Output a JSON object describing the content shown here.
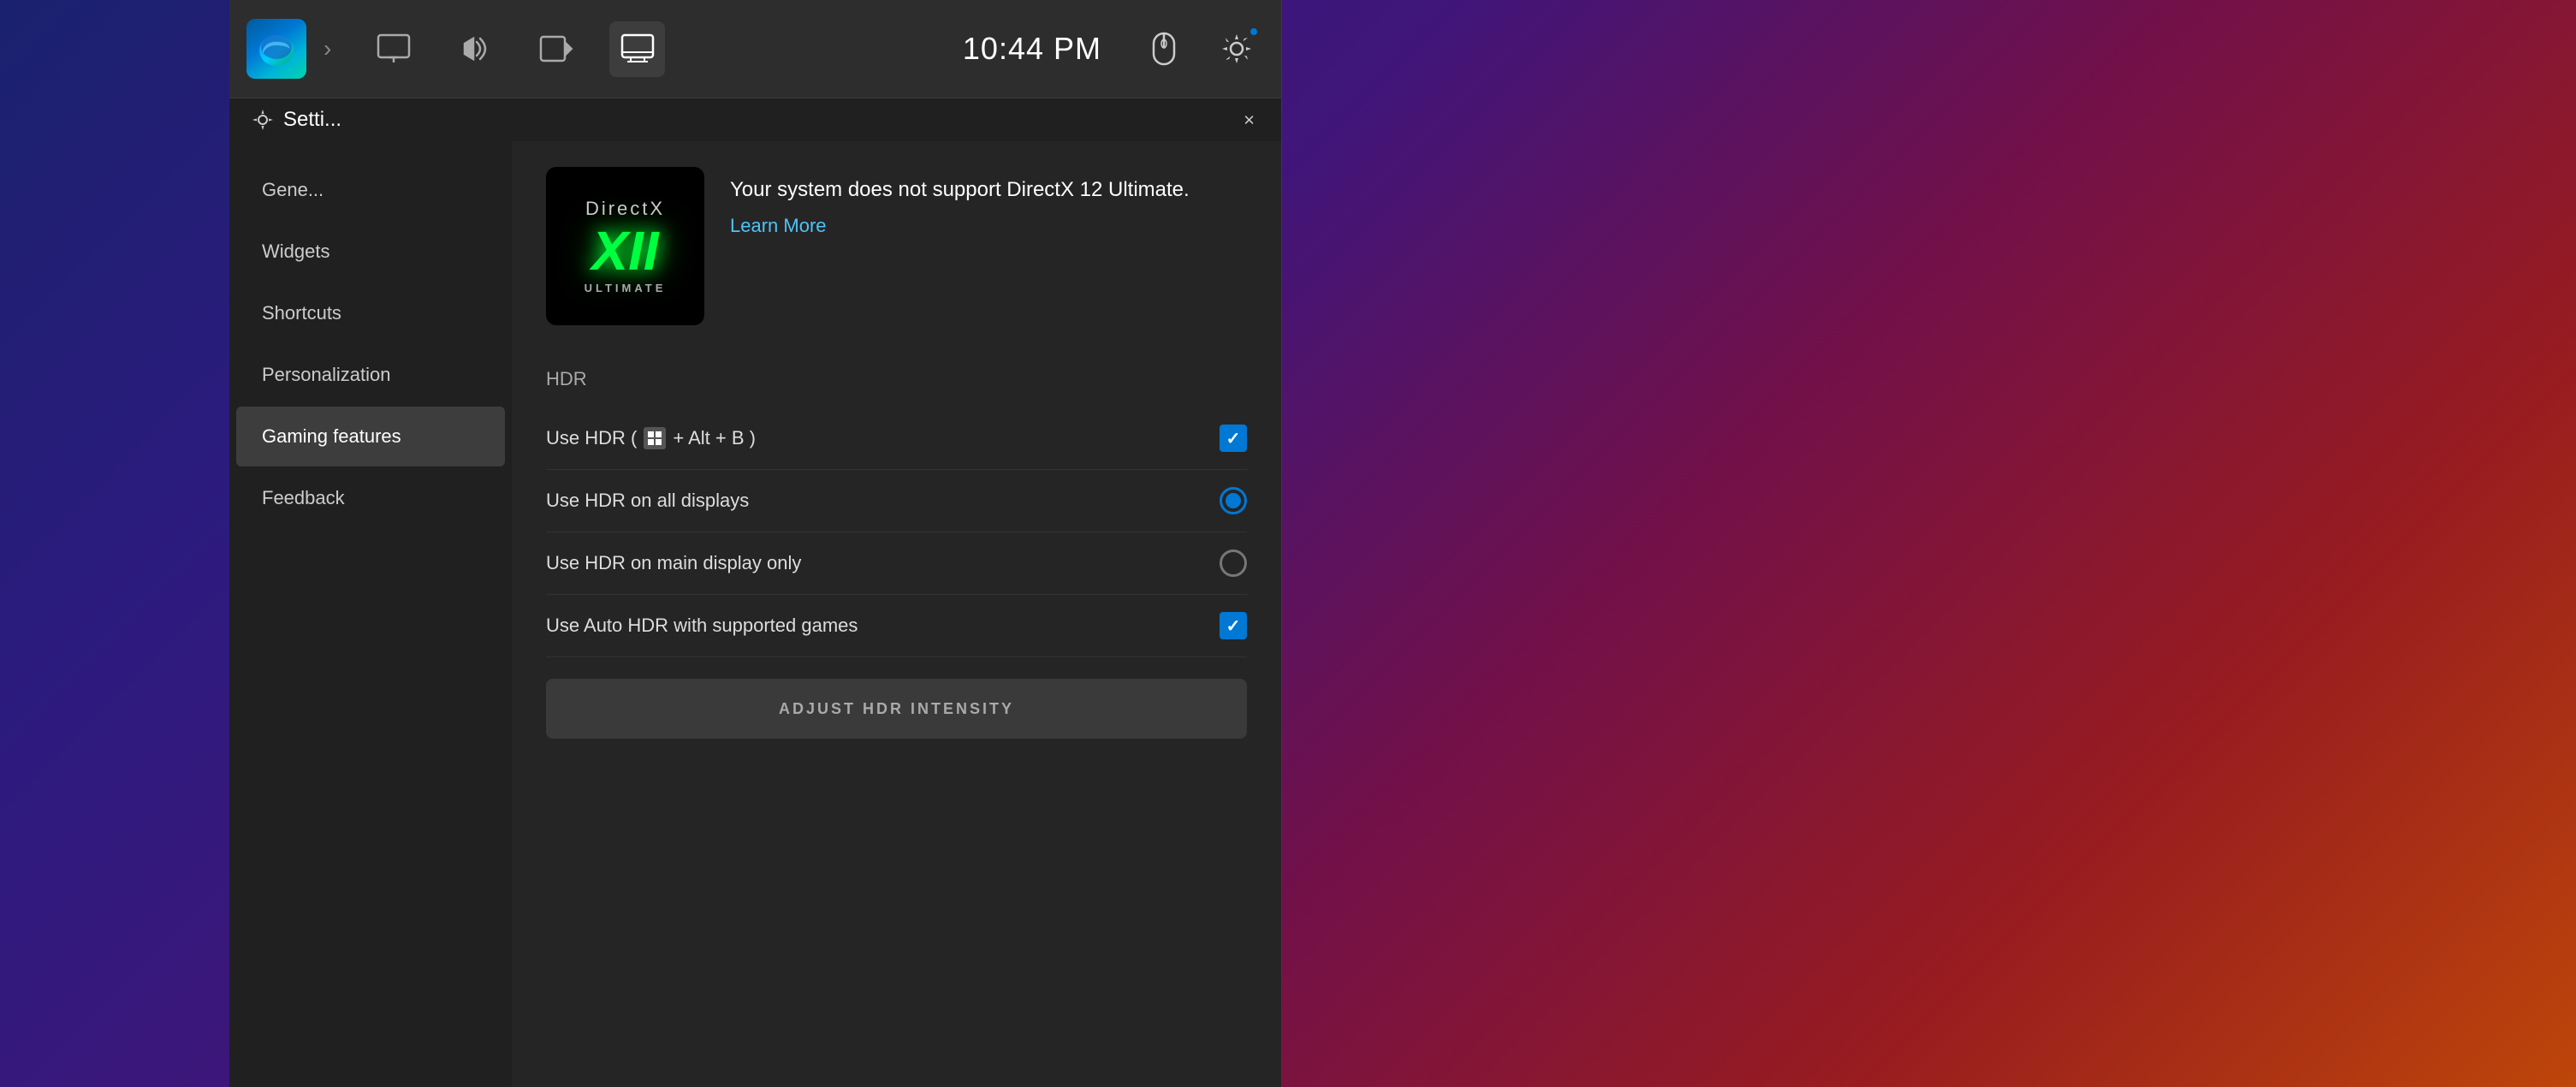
{
  "window": {
    "title": "Setti...",
    "close_label": "×"
  },
  "toolbar": {
    "time": "10:44 PM",
    "icons": [
      {
        "name": "display-icon",
        "label": "Display"
      },
      {
        "name": "audio-icon",
        "label": "Audio"
      },
      {
        "name": "screen-record-icon",
        "label": "Screen Record"
      },
      {
        "name": "monitor-icon",
        "label": "Monitor",
        "active": true
      }
    ]
  },
  "sidebar": {
    "items": [
      {
        "id": "general",
        "label": "Gene...",
        "active": false
      },
      {
        "id": "widgets",
        "label": "Widgets",
        "active": false
      },
      {
        "id": "shortcuts",
        "label": "Shortcuts",
        "active": false
      },
      {
        "id": "personalization",
        "label": "Personalization",
        "active": false
      },
      {
        "id": "gaming",
        "label": "Gaming features",
        "active": true
      },
      {
        "id": "feedback",
        "label": "Feedback",
        "active": false
      }
    ]
  },
  "directx": {
    "logo_line1": "DirectX",
    "logo_line2": "XII",
    "logo_line3": "ULTIMATE",
    "message": "Your system does not support DirectX 12 Ultimate.",
    "learn_more": "Learn More"
  },
  "hdr": {
    "section_label": "HDR",
    "settings": [
      {
        "id": "use-hdr",
        "label_prefix": "Use HDR (",
        "label_key": "win",
        "label_suffix": " + Alt + B )",
        "type": "checkbox",
        "checked": true
      },
      {
        "id": "hdr-all-displays",
        "label": "Use HDR on all displays",
        "type": "radio",
        "selected": true
      },
      {
        "id": "hdr-main-display",
        "label": "Use HDR on main display only",
        "type": "radio",
        "selected": false
      },
      {
        "id": "auto-hdr",
        "label": "Use Auto HDR with supported games",
        "type": "checkbox",
        "checked": true
      }
    ],
    "adjust_button": "ADJUST HDR INTENSITY"
  }
}
